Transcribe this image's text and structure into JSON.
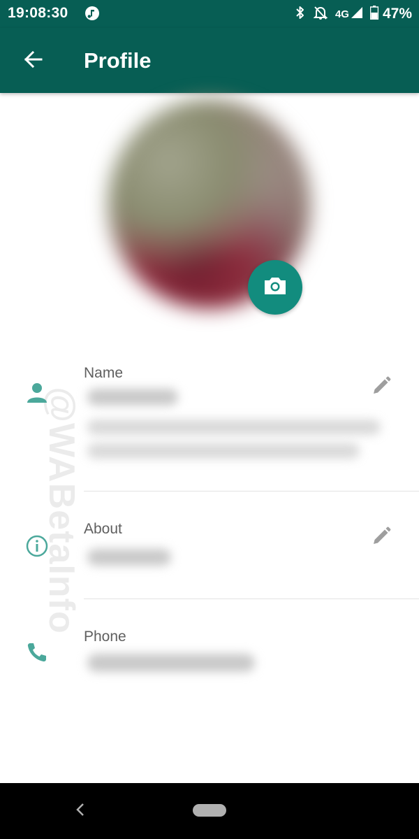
{
  "status_bar": {
    "time": "19:08:30",
    "network": "4G",
    "battery": "47%"
  },
  "app_bar": {
    "title": "Profile"
  },
  "watermark": "@WABetaInfo",
  "fields": {
    "name": {
      "label": "Name"
    },
    "about": {
      "label": "About"
    },
    "phone": {
      "label": "Phone"
    }
  },
  "colors": {
    "primary_dark": "#075e54",
    "accent": "#128c7e",
    "icon": "#4ba89b"
  },
  "icons": [
    "back-arrow-icon",
    "camera-icon",
    "person-icon",
    "info-icon",
    "phone-icon",
    "pencil-icon"
  ]
}
